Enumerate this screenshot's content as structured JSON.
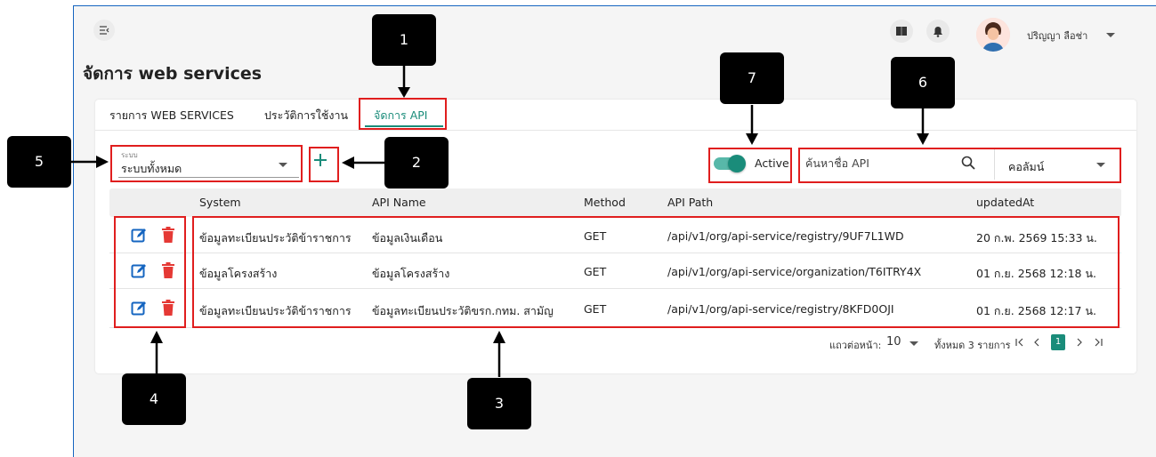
{
  "header": {
    "user_name": "ปริญญา ลือช่า",
    "page_title": "จัดการ web services"
  },
  "tabs": [
    {
      "label": "รายการ WEB SERVICES"
    },
    {
      "label": "ประวัติการใช้งาน"
    },
    {
      "label": "จัดการ API"
    }
  ],
  "filters": {
    "system_label": "ระบบ",
    "system_value": "ระบบทั้งหมด",
    "active_label": "Active",
    "search_placeholder": "ค้นหาชื่อ API",
    "column_select": "คอลัมน์"
  },
  "table": {
    "columns": [
      "System",
      "API Name",
      "Method",
      "API Path",
      "updatedAt"
    ],
    "rows": [
      {
        "system": "ข้อมูลทะเบียนประวัติข้าราชการ",
        "api_name": "ข้อมูลเงินเดือน",
        "method": "GET",
        "api_path": "/api/v1/org/api-service/registry/9UF7L1WD",
        "updated": "20 ก.พ. 2569 15:33 น."
      },
      {
        "system": "ข้อมูลโครงสร้าง",
        "api_name": "ข้อมูลโครงสร้าง",
        "method": "GET",
        "api_path": "/api/v1/org/api-service/organization/T6ITRY4X",
        "updated": "01 ก.ย. 2568 12:18 น."
      },
      {
        "system": "ข้อมูลทะเบียนประวัติข้าราชการ",
        "api_name": "ข้อมูลทะเบียนประวัติขรก.กทม. สามัญ",
        "method": "GET",
        "api_path": "/api/v1/org/api-service/registry/8KFD0OJI",
        "updated": "01 ก.ย. 2568 12:17 น."
      }
    ]
  },
  "pagination": {
    "rows_per_page_label": "แถวต่อหน้า:",
    "rows_per_page": "10",
    "total_label": "ทั้งหมด 3 รายการ",
    "current_page": "1"
  },
  "callouts": [
    "1",
    "2",
    "3",
    "4",
    "5",
    "6",
    "7"
  ],
  "colors": {
    "accent": "#1a8c7a",
    "highlight": "#e01e1e",
    "delete": "#e53935"
  }
}
